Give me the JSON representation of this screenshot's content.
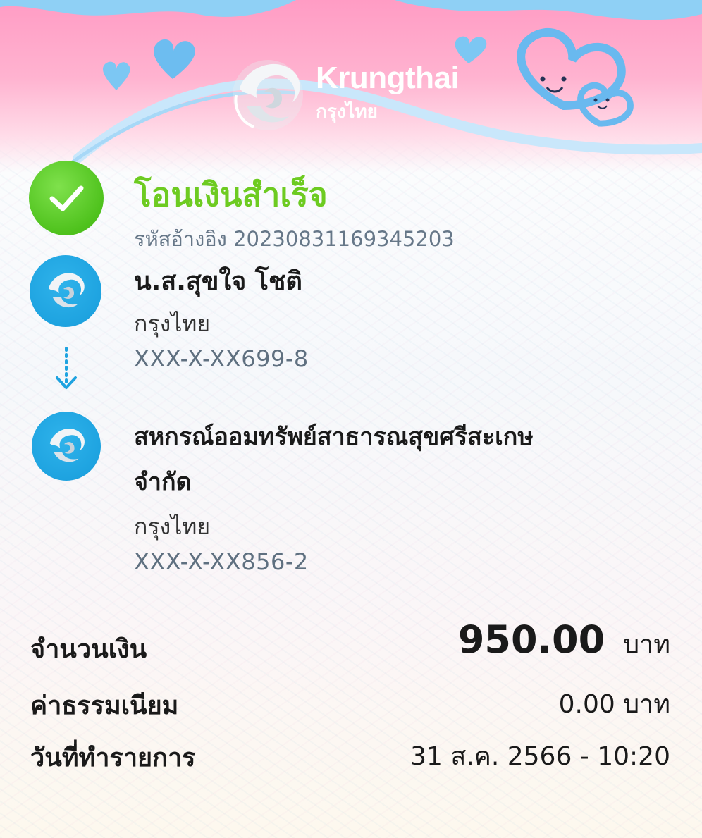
{
  "brand": {
    "name_en": "Krungthai",
    "name_th": "กรุงไทย"
  },
  "status": {
    "title": "โอนเงินสำเร็จ",
    "ref_label": "รหัสอ้างอิง",
    "ref_no": "20230831169345203"
  },
  "sender": {
    "name": "น.ส.สุขใจ โชติ",
    "bank": "กรุงไทย",
    "account": "XXX-X-XX699-8"
  },
  "receiver": {
    "name_line1": "สหกรณ์ออมทรัพย์สาธารณสุขศรีสะเกษ",
    "name_line2": "จำกัด",
    "bank": "กรุงไทย",
    "account": "XXX-X-XX856-2"
  },
  "details": {
    "amount_label": "จำนวนเงิน",
    "amount": "950.00",
    "amount_unit": "บาท",
    "fee_label": "ค่าธรรมเนียม",
    "fee": "0.00 บาท",
    "date_label": "วันที่ทำรายการ",
    "date": "31 ส.ค. 2566 - 10:20"
  },
  "colors": {
    "success": "#6dcb21",
    "bank_blue": "#1ea3e0",
    "banner_pink": "#ff9cc4"
  }
}
